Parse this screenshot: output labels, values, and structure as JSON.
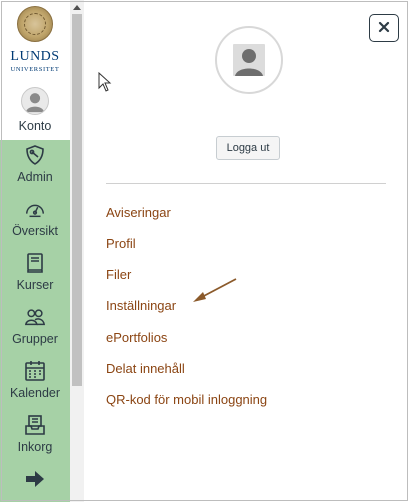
{
  "logo": {
    "line1": "LUNDS",
    "line2": "UNIVERSITET",
    "seal_icon": "university-seal"
  },
  "nav": {
    "items": [
      {
        "label": "Konto",
        "icon": "user-avatar-icon"
      },
      {
        "label": "Admin",
        "icon": "shield-icon"
      },
      {
        "label": "Översikt",
        "icon": "dashboard-gauge-icon"
      },
      {
        "label": "Kurser",
        "icon": "book-icon"
      },
      {
        "label": "Grupper",
        "icon": "people-icon"
      },
      {
        "label": "Kalender",
        "icon": "calendar-icon"
      },
      {
        "label": "Inkorg",
        "icon": "inbox-icon"
      },
      {
        "label": "",
        "icon": "arrow-right-exit-icon"
      }
    ]
  },
  "tray": {
    "close_icon": "×",
    "logout_label": "Logga ut",
    "links": [
      "Aviseringar",
      "Profil",
      "Filer",
      "Inställningar",
      "ePortfolios",
      "Delat innehåll",
      "QR-kod för mobil inloggning"
    ]
  },
  "colors": {
    "nav_active_bg": "#a6d1a6",
    "link_color": "#8b4513",
    "brand_blue": "#003a74",
    "text": "#2d3b45",
    "annotation_arrow": "#8b5a2b"
  }
}
